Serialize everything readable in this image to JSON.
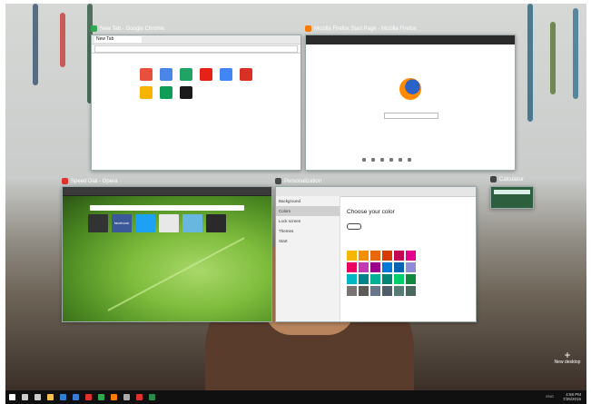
{
  "windows": {
    "chrome": {
      "caption": "New Tab - Google Chrome",
      "tab_label": "New Tab",
      "apps": [
        {
          "name": "web-store-app-icon",
          "color": "#e84f3c"
        },
        {
          "name": "docs-app-icon",
          "color": "#4a86e8"
        },
        {
          "name": "drive-app-icon",
          "color": "#1fa463"
        },
        {
          "name": "youtube-app-icon",
          "color": "#e62117"
        },
        {
          "name": "search-app-icon",
          "color": "#4285f4"
        },
        {
          "name": "gmail-app-icon",
          "color": "#d93025"
        },
        {
          "name": "slides-app-icon",
          "color": "#f4b400"
        },
        {
          "name": "sheets-app-icon",
          "color": "#0f9d58"
        },
        {
          "name": "other-app-icon",
          "color": "#1a1a1a"
        }
      ]
    },
    "firefox": {
      "caption": "Mozilla Firefox Start Page - Mozilla Firefox"
    },
    "opera": {
      "caption": "Speed Dial - Opera",
      "tiles": [
        {
          "name": "dial-tile-1",
          "color": "#333333"
        },
        {
          "name": "dial-tile-facebook",
          "color": "#3b5998",
          "label": "facebook"
        },
        {
          "name": "dial-tile-twitter",
          "color": "#1da1f2"
        },
        {
          "name": "dial-tile-4",
          "color": "#e8e8e8"
        },
        {
          "name": "dial-tile-5",
          "color": "#67b7e1"
        },
        {
          "name": "dial-tile-6",
          "color": "#2a2a2a"
        }
      ]
    },
    "settings": {
      "caption": "Personalization",
      "section_title": "Choose your color",
      "side_items": [
        "Background",
        "Colors",
        "Lock screen",
        "Themes",
        "Start"
      ],
      "selected_index": 1,
      "swatches": [
        "#f7b500",
        "#f48f00",
        "#e8660c",
        "#d83b01",
        "#c30052",
        "#e3008c",
        "#ea005e",
        "#c239b3",
        "#9a0089",
        "#0078d7",
        "#0063b1",
        "#8e8cd8",
        "#00b7c3",
        "#038387",
        "#00b294",
        "#018574",
        "#00cc6a",
        "#10893e",
        "#7a7574",
        "#5d5a58",
        "#68768a",
        "#515c6b",
        "#567c73",
        "#486860"
      ]
    },
    "mini": {
      "caption": "Calculator"
    }
  },
  "new_desktop": {
    "label": "New desktop",
    "symbol": "+"
  },
  "taskbar": {
    "icons": [
      {
        "name": "start-icon",
        "color": "#ffffff"
      },
      {
        "name": "search-icon",
        "color": "#cccccc"
      },
      {
        "name": "task-view-icon",
        "color": "#cccccc"
      },
      {
        "name": "file-explorer-icon",
        "color": "#f2c14e"
      },
      {
        "name": "edge-icon",
        "color": "#2f7fd6"
      },
      {
        "name": "store-icon",
        "color": "#3a7bd5"
      },
      {
        "name": "opera-icon",
        "color": "#e03030"
      },
      {
        "name": "chrome-icon",
        "color": "#2fa84f"
      },
      {
        "name": "firefox-icon",
        "color": "#ff7b00"
      },
      {
        "name": "settings-icon",
        "color": "#aaaaaa"
      },
      {
        "name": "app-icon",
        "color": "#e03030"
      },
      {
        "name": "app2-icon",
        "color": "#2a8a4a"
      }
    ],
    "tray_text": "ENG",
    "time": "4:58 PM",
    "date": "7/25/2015"
  }
}
